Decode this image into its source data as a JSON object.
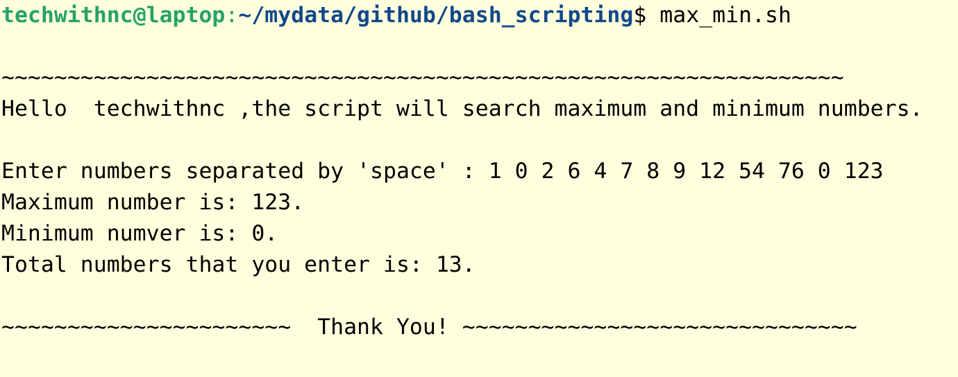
{
  "terminal": {
    "background": "#ffffdd",
    "colors": {
      "user_host": "#26a269",
      "path": "#12488b",
      "text": "#000000"
    },
    "prompt": {
      "user_host": "techwithnc@laptop",
      "separator": ":",
      "path": "~/mydata/github/bash_scripting",
      "symbol": "$",
      "command": " max_min.sh"
    },
    "lines": {
      "separator_top": "~~~~~~~~~~~~~~~~~~~~~~~~~~~~~~~~~~~~~~~~~~~~~~~~~~~~~~~~~~~~~~~~",
      "greeting": "Hello  techwithnc ,the script will search maximum and minimum numbers.",
      "input_prompt": "Enter numbers separated by 'space' : 1 0 2 6 4 7 8 9 12 54 76 0 123",
      "max_result": "Maximum number is: 123.",
      "min_result": "Minimum numver is: 0.",
      "total_result": "Total numbers that you enter is: 13.",
      "footer": "~~~~~~~~~~~~~~~~~~~~~~  Thank You! ~~~~~~~~~~~~~~~~~~~~~~~~~~~~~~"
    }
  }
}
